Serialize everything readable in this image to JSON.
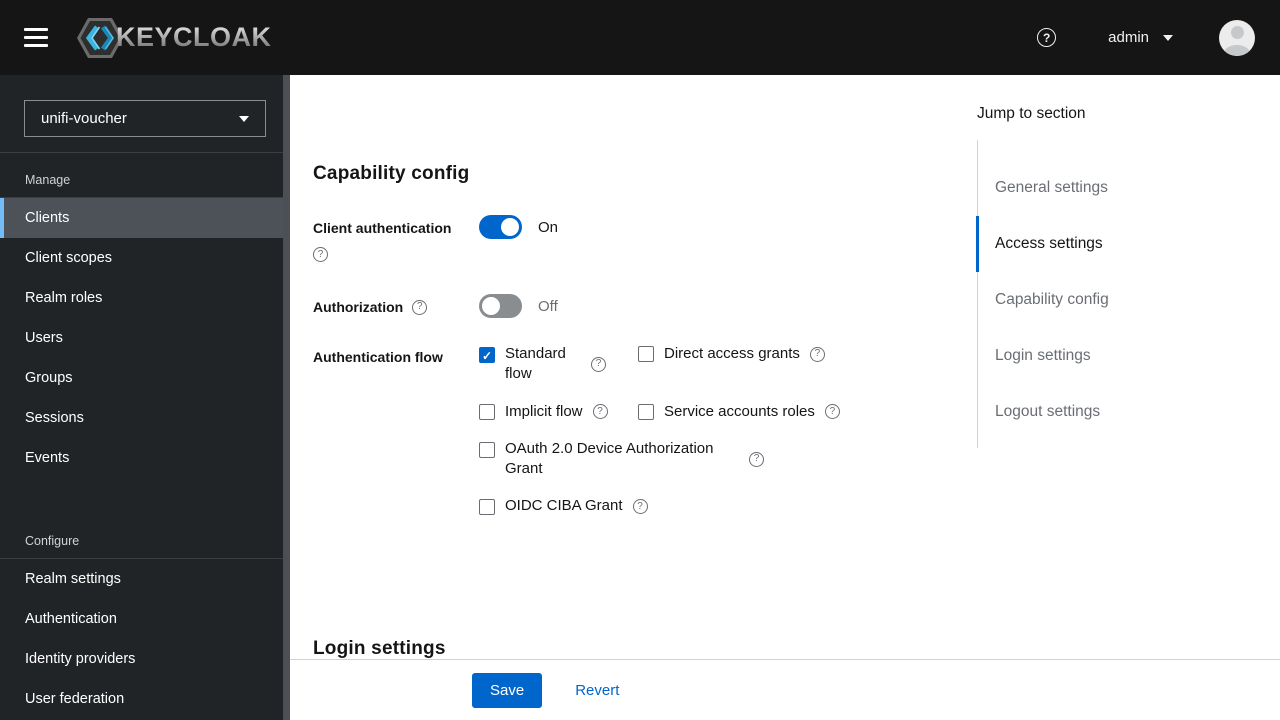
{
  "header": {
    "brand_text": "KEYCLOAK",
    "user_name": "admin"
  },
  "sidebar": {
    "realm": "unifi-voucher",
    "groups": [
      {
        "title": "Manage",
        "items": [
          {
            "label": "Clients",
            "active": true
          },
          {
            "label": "Client scopes",
            "active": false
          },
          {
            "label": "Realm roles",
            "active": false
          },
          {
            "label": "Users",
            "active": false
          },
          {
            "label": "Groups",
            "active": false
          },
          {
            "label": "Sessions",
            "active": false
          },
          {
            "label": "Events",
            "active": false
          }
        ]
      },
      {
        "title": "Configure",
        "items": [
          {
            "label": "Realm settings",
            "active": false
          },
          {
            "label": "Authentication",
            "active": false
          },
          {
            "label": "Identity providers",
            "active": false
          },
          {
            "label": "User federation",
            "active": false
          }
        ]
      }
    ]
  },
  "main": {
    "capability": {
      "title": "Capability config",
      "client_auth": {
        "label": "Client authentication",
        "state": "On",
        "on": true
      },
      "authorization": {
        "label": "Authorization",
        "state": "Off",
        "on": false
      },
      "auth_flow": {
        "label": "Authentication flow",
        "options": [
          {
            "label": "Standard flow",
            "checked": true
          },
          {
            "label": "Direct access grants",
            "checked": false
          },
          {
            "label": "Implicit flow",
            "checked": false
          },
          {
            "label": "Service accounts roles",
            "checked": false
          },
          {
            "label": "OAuth 2.0 Device Authorization Grant",
            "checked": false
          },
          {
            "label": "OIDC CIBA Grant",
            "checked": false
          }
        ]
      }
    },
    "login_settings_title": "Login settings",
    "actions": {
      "save": "Save",
      "revert": "Revert"
    }
  },
  "jump": {
    "title": "Jump to section",
    "items": [
      {
        "label": "General settings",
        "active": false
      },
      {
        "label": "Access settings",
        "active": true
      },
      {
        "label": "Capability config",
        "active": false
      },
      {
        "label": "Login settings",
        "active": false
      },
      {
        "label": "Logout settings",
        "active": false
      }
    ]
  },
  "icons": {
    "help": "?"
  },
  "colors": {
    "primary_blue": "#0066cc",
    "nav_active_border": "#73bcf7",
    "header_bg": "#151515",
    "sidebar_bg": "#212427",
    "toggle_off_gray": "#8a8d90",
    "muted_text": "#6a6e73"
  }
}
